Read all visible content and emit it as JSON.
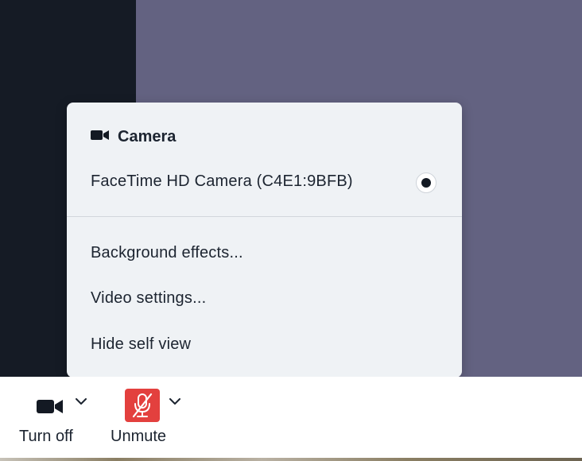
{
  "menu": {
    "header": {
      "title": "Camera",
      "icon": "video-camera-icon"
    },
    "devices": [
      {
        "label": "FaceTime HD Camera (C4E1:9BFB)",
        "selected": true
      }
    ],
    "items": [
      {
        "label": "Background effects..."
      },
      {
        "label": "Video settings..."
      },
      {
        "label": "Hide self view"
      }
    ]
  },
  "toolbar": {
    "camera": {
      "label": "Turn off",
      "icon": "video-camera-icon",
      "caret_icon": "chevron-down-icon"
    },
    "mic": {
      "label": "Unmute",
      "icon": "microphone-off-icon",
      "caret_icon": "chevron-down-icon",
      "color": "#e3403e"
    }
  },
  "colors": {
    "menu_bg": "#eff2f5",
    "video_tile": "#636281",
    "left_pane": "#151b25",
    "text": "#1c2430"
  }
}
